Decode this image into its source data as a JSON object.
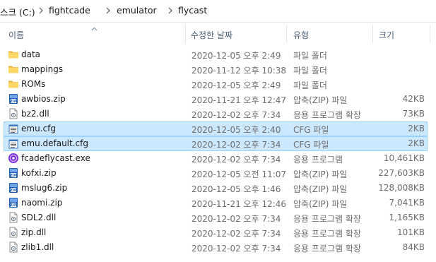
{
  "breadcrumb": [
    "스크 (C:)",
    "fightcade",
    "emulator",
    "flycast"
  ],
  "columns": {
    "name": "이름",
    "date": "수정한 날짜",
    "type": "유형",
    "size": "크기"
  },
  "files": [
    {
      "name": "data",
      "date": "2020-12-05 오후 2:49",
      "type": "파일 폴더",
      "size": "",
      "icon": "folder-icon",
      "selected": false
    },
    {
      "name": "mappings",
      "date": "2020-11-12 오후 10:38",
      "type": "파일 폴더",
      "size": "",
      "icon": "folder-icon",
      "selected": false
    },
    {
      "name": "ROMs",
      "date": "2020-12-05 오후 2:49",
      "type": "파일 폴더",
      "size": "",
      "icon": "folder-icon",
      "selected": false
    },
    {
      "name": "awbios.zip",
      "date": "2020-11-21 오후 12:47",
      "type": "압축(ZIP) 파일",
      "size": "42KB",
      "icon": "zip-icon",
      "selected": false
    },
    {
      "name": "bz2.dll",
      "date": "2020-12-02 오후 7:34",
      "type": "응용 프로그램 확장",
      "size": "73KB",
      "icon": "dll-icon",
      "selected": false
    },
    {
      "name": "emu.cfg",
      "date": "2020-12-05 오후 2:40",
      "type": "CFG 파일",
      "size": "2KB",
      "icon": "cfg-icon",
      "selected": true
    },
    {
      "name": "emu.default.cfg",
      "date": "2020-12-02 오후 7:34",
      "type": "CFG 파일",
      "size": "2KB",
      "icon": "cfg-icon",
      "selected": true
    },
    {
      "name": "fcadeflycast.exe",
      "date": "2020-12-02 오후 7:34",
      "type": "응용 프로그램",
      "size": "10,461KB",
      "icon": "flycast-app-icon",
      "selected": false
    },
    {
      "name": "kofxi.zip",
      "date": "2020-12-05 오전 11:07",
      "type": "압축(ZIP) 파일",
      "size": "227,603KB",
      "icon": "zip-icon",
      "selected": false
    },
    {
      "name": "mslug6.zip",
      "date": "2020-12-05 오후 1:46",
      "type": "압축(ZIP) 파일",
      "size": "128,008KB",
      "icon": "zip-icon",
      "selected": false
    },
    {
      "name": "naomi.zip",
      "date": "2020-11-21 오후 12:46",
      "type": "압축(ZIP) 파일",
      "size": "7,041KB",
      "icon": "zip-icon",
      "selected": false
    },
    {
      "name": "SDL2.dll",
      "date": "2020-12-02 오후 7:34",
      "type": "응용 프로그램 확장",
      "size": "1,165KB",
      "icon": "dll-icon",
      "selected": false
    },
    {
      "name": "zip.dll",
      "date": "2020-12-02 오후 7:34",
      "type": "응용 프로그램 확장",
      "size": "101KB",
      "icon": "dll-icon",
      "selected": false
    },
    {
      "name": "zlib1.dll",
      "date": "2020-12-02 오후 7:34",
      "type": "응용 프로그램 확장",
      "size": "84KB",
      "icon": "dll-icon",
      "selected": false
    }
  ]
}
